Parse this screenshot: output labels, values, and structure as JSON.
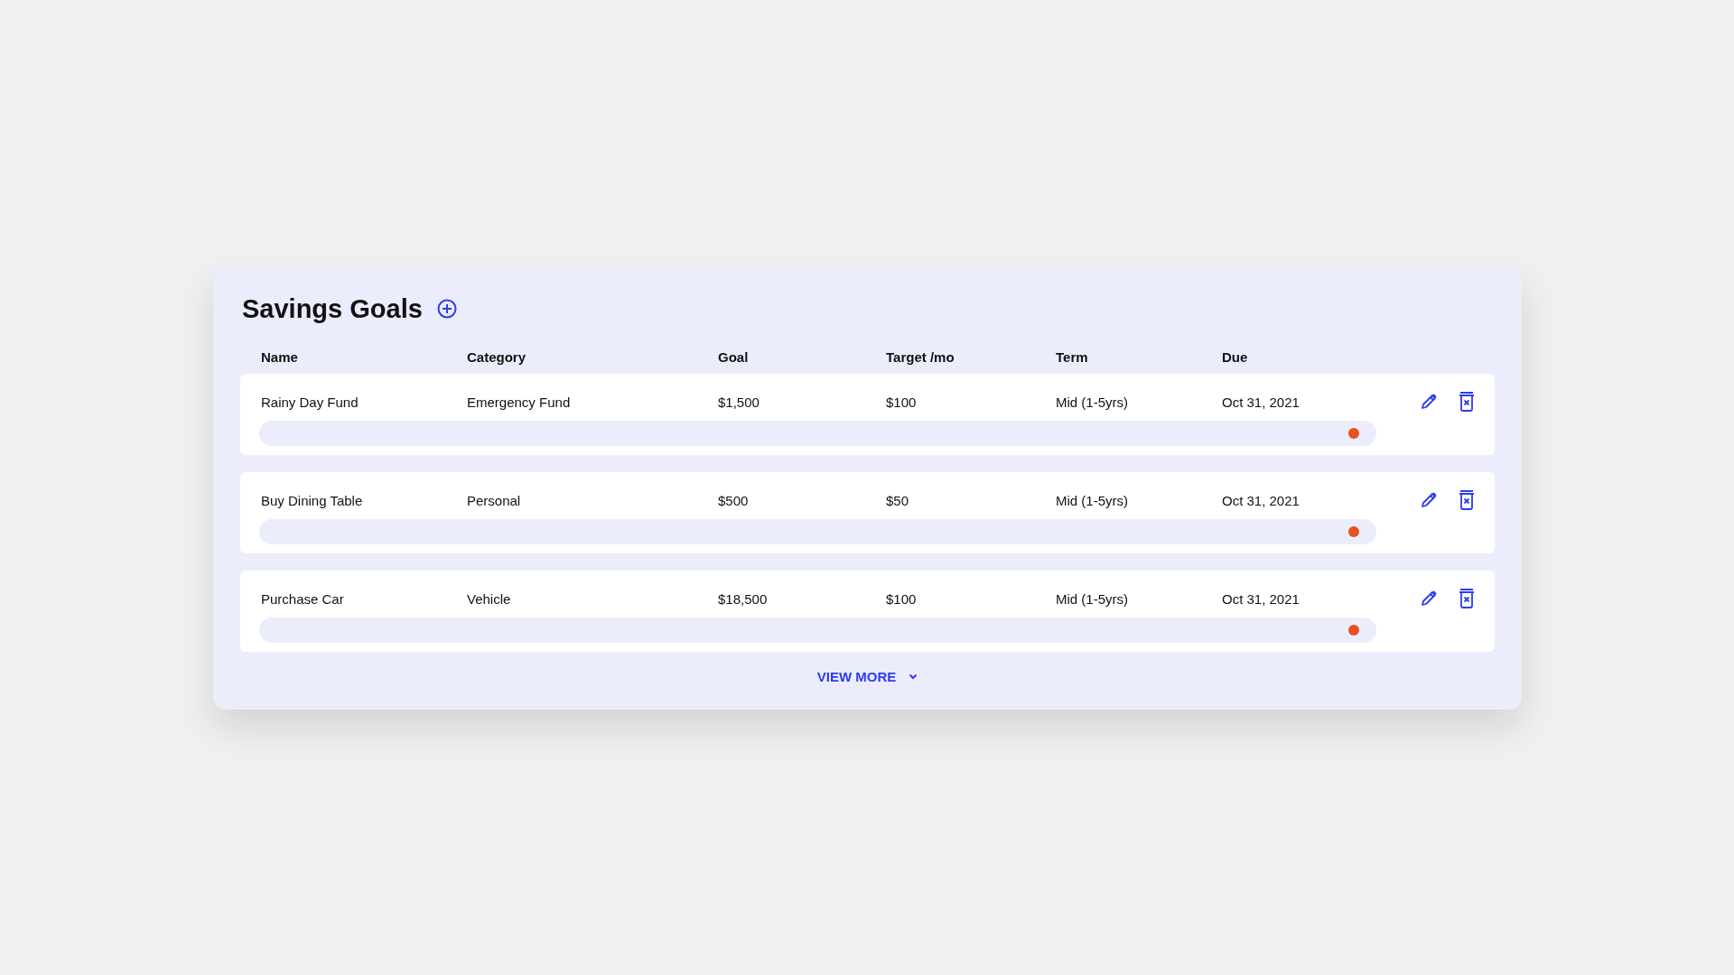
{
  "title": "Savings Goals",
  "columns": [
    "Name",
    "Category",
    "Goal",
    "Target /mo",
    "Term",
    "Due"
  ],
  "rows": [
    {
      "name": "Rainy Day Fund",
      "category": "Emergency Fund",
      "goal": "$1,500",
      "target": "$100",
      "term": "Mid (1-5yrs)",
      "due": "Oct 31, 2021",
      "level": 0.985
    },
    {
      "name": "Buy Dining Table",
      "category": "Personal",
      "goal": "$500",
      "target": "$50",
      "term": "Mid (1-5yrs)",
      "due": "Oct 31, 2021",
      "level": 0.985
    },
    {
      "name": "Purchase Car",
      "category": "Vehicle",
      "goal": "$18,500",
      "target": "$100",
      "term": "Mid (1-5yrs)",
      "due": "Oct 31, 2021",
      "level": 0.985
    }
  ],
  "view_more": "VIEW MORE"
}
